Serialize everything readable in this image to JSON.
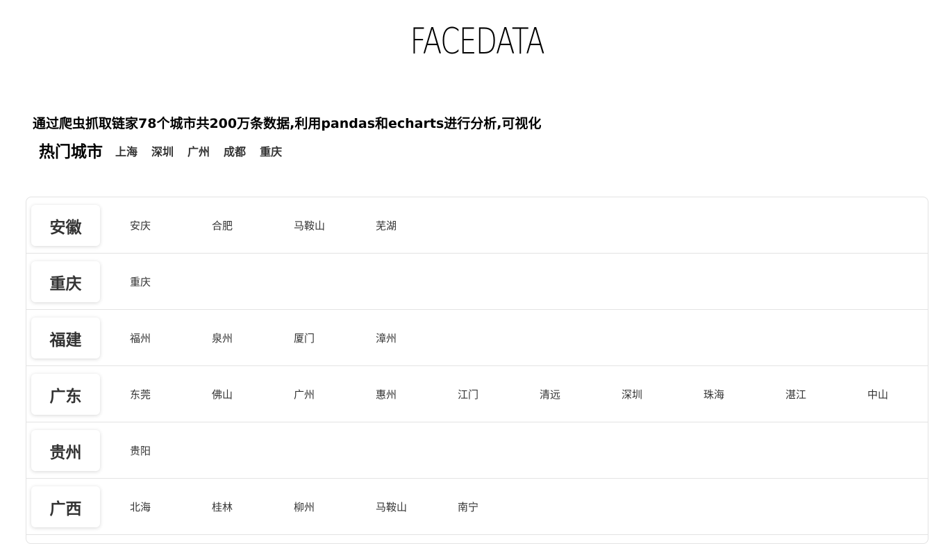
{
  "logo": "FACEDATA",
  "intro": "通过爬虫抓取链家78个城市共200万条数据,利用pandas和echarts进行分析,可视化",
  "hot": {
    "title": "热门城市",
    "cities": [
      "上海",
      "深圳",
      "广州",
      "成都",
      "重庆"
    ]
  },
  "provinces": [
    {
      "name": "安徽",
      "cities": [
        "安庆",
        "合肥",
        "马鞍山",
        "芜湖"
      ]
    },
    {
      "name": "重庆",
      "cities": [
        "重庆"
      ]
    },
    {
      "name": "福建",
      "cities": [
        "福州",
        "泉州",
        "厦门",
        "漳州"
      ]
    },
    {
      "name": "广东",
      "cities": [
        "东莞",
        "佛山",
        "广州",
        "惠州",
        "江门",
        "清远",
        "深圳",
        "珠海",
        "湛江",
        "中山"
      ]
    },
    {
      "name": "贵州",
      "cities": [
        "贵阳"
      ]
    },
    {
      "name": "广西",
      "cities": [
        "北海",
        "桂林",
        "柳州",
        "马鞍山",
        "南宁"
      ]
    }
  ]
}
